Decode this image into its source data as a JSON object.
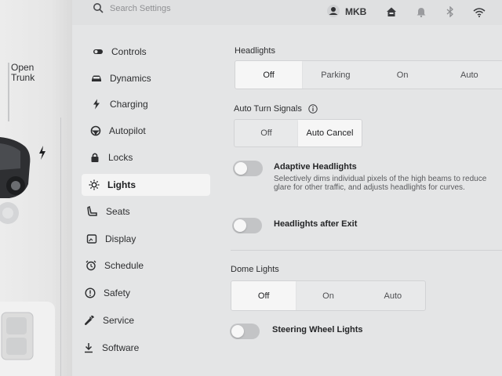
{
  "car_panel": {
    "open_trunk_line1": "Open",
    "open_trunk_line2": "Trunk"
  },
  "topbar": {
    "search_placeholder": "Search Settings",
    "user_name": "MKB",
    "icons": [
      "search-icon",
      "user-icon",
      "home-icon",
      "bell-icon",
      "bluetooth-icon",
      "wifi-icon"
    ]
  },
  "sidebar": {
    "items": [
      {
        "label": "Controls",
        "icon": "toggle-icon"
      },
      {
        "label": "Dynamics",
        "icon": "car-icon"
      },
      {
        "label": "Charging",
        "icon": "bolt-icon"
      },
      {
        "label": "Autopilot",
        "icon": "steering-wheel-icon"
      },
      {
        "label": "Locks",
        "icon": "lock-icon"
      },
      {
        "label": "Lights",
        "icon": "sun-icon",
        "active": true
      },
      {
        "label": "Seats",
        "icon": "seat-icon"
      },
      {
        "label": "Display",
        "icon": "display-icon"
      },
      {
        "label": "Schedule",
        "icon": "alarm-clock-icon"
      },
      {
        "label": "Safety",
        "icon": "alert-circle-icon"
      },
      {
        "label": "Service",
        "icon": "wrench-icon"
      },
      {
        "label": "Software",
        "icon": "download-icon"
      }
    ]
  },
  "headlights": {
    "title": "Headlights",
    "options": [
      "Off",
      "Parking",
      "On",
      "Auto"
    ],
    "selected": "Off"
  },
  "auto_turn_signals": {
    "title": "Auto Turn Signals",
    "options": [
      "Off",
      "Auto Cancel"
    ],
    "selected": "Auto Cancel"
  },
  "adaptive_headlights": {
    "label": "Adaptive Headlights",
    "description": "Selectively dims individual pixels of the high beams to reduce glare for other traffic, and adjusts headlights for curves.",
    "enabled": false
  },
  "headlights_after_exit": {
    "label": "Headlights after Exit",
    "enabled": false
  },
  "dome_lights": {
    "title": "Dome Lights",
    "options": [
      "Off",
      "On",
      "Auto"
    ],
    "selected": "Off"
  },
  "steering_wheel_lights": {
    "label": "Steering Wheel Lights",
    "enabled": false
  }
}
